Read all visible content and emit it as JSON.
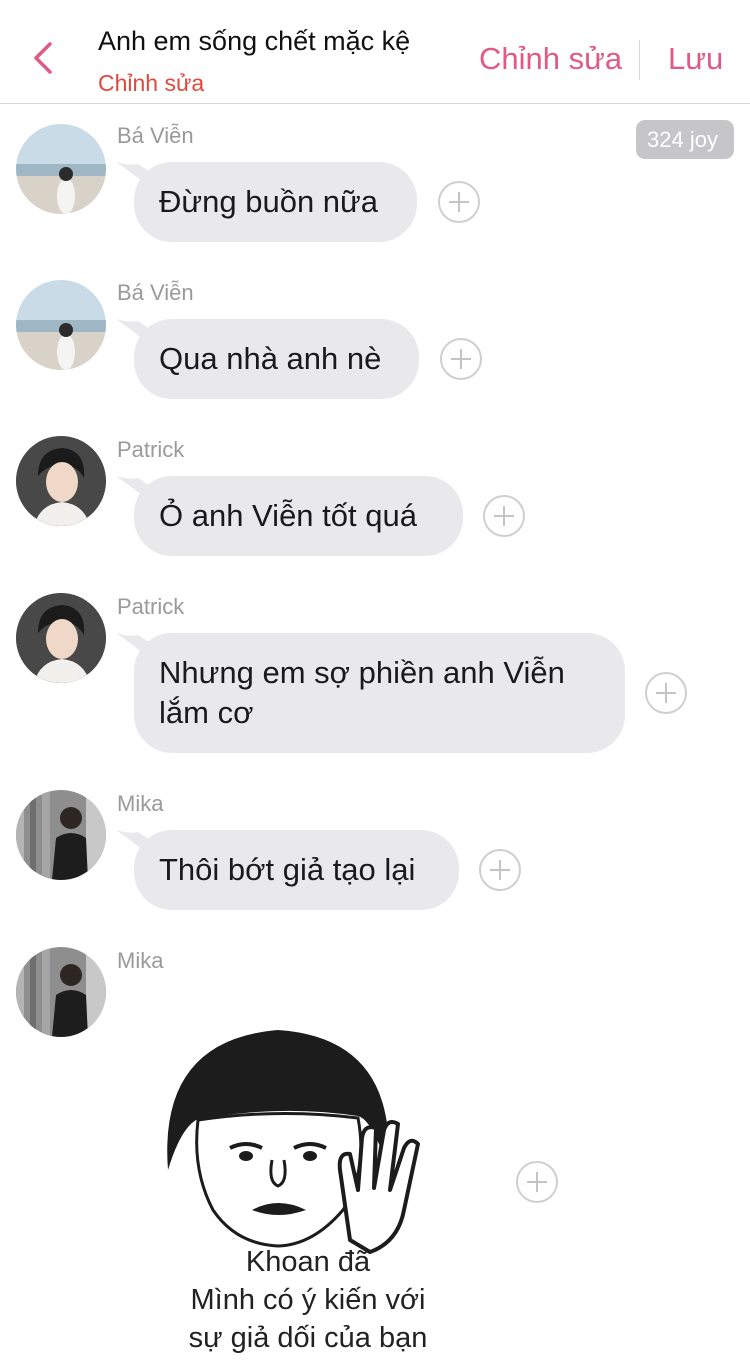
{
  "header": {
    "title": "Anh em sống chết mặc kệ",
    "subtitle": "Chỉnh sửa",
    "edit_label": "Chỉnh sửa",
    "save_label": "Lưu",
    "accent_color": "#e05a84"
  },
  "joy_badge": "324 joy",
  "messages": [
    {
      "sender": "Bá Viễn",
      "text": "Đừng buồn nữa"
    },
    {
      "sender": "Bá Viễn",
      "text": "Qua nhà anh nè"
    },
    {
      "sender": "Patrick",
      "text": "Ỏ anh Viễn tốt quá"
    },
    {
      "sender": "Patrick",
      "text_line1": "Nhưng em sợ phiền anh Viễn",
      "text_line2": "lắm cơ"
    },
    {
      "sender": "Mika",
      "text": "Thôi bớt giả tạo lại"
    },
    {
      "sender": "Mika",
      "sticker_line1": "Khoan đã",
      "sticker_line2": "Mình có ý kiến với",
      "sticker_line3": "sự giả dối của bạn"
    }
  ]
}
